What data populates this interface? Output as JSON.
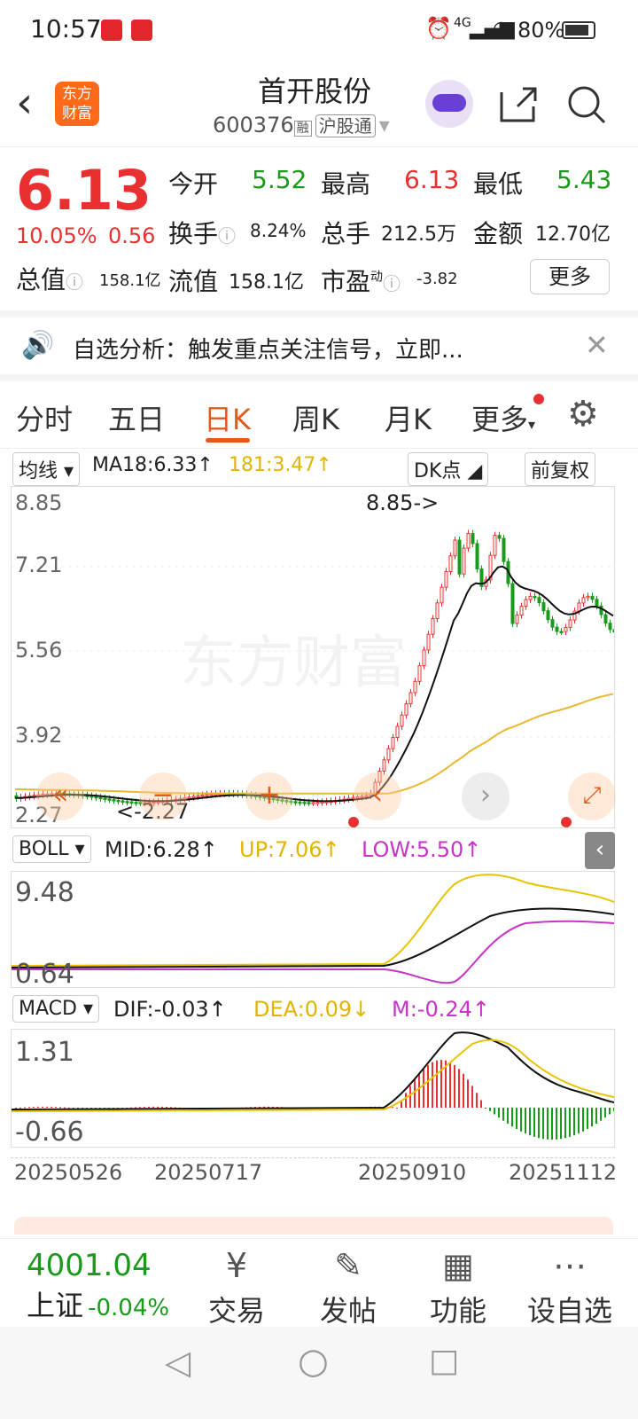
{
  "status": {
    "time": "10:57",
    "network": "4G",
    "battery": "80%"
  },
  "header": {
    "title": "首开股份",
    "code": "600376",
    "tag_rong": "融",
    "tag_hgt": "沪股通",
    "logo_text_1": "东方",
    "logo_text_2": "财富"
  },
  "quote": {
    "price": "6.13",
    "change_pct": "10.05%",
    "change": "0.56",
    "open_label": "今开",
    "open": "5.52",
    "high_label": "最高",
    "high": "6.13",
    "low_label": "最低",
    "low": "5.43",
    "turnover_label": "换手",
    "turnover": "8.24%",
    "volume_label": "总手",
    "volume": "212.5万",
    "amount_label": "金额",
    "amount": "12.70亿",
    "mktcap_label": "总值",
    "mktcap": "158.1亿",
    "float_label": "流值",
    "float": "158.1亿",
    "pe_label": "市盈",
    "pe_sup": "动",
    "pe": "-3.82",
    "more": "更多"
  },
  "banner": {
    "text": "自选分析：触发重点关注信号，立即..."
  },
  "tabs": [
    "分时",
    "五日",
    "日K",
    "周K",
    "月K",
    "更多"
  ],
  "kline": {
    "ma_select": "均线",
    "ma18": "MA18:6.33↑",
    "ma181": "181:3.47↑",
    "dk": "DK点",
    "adjust": "前复权",
    "y_labels": [
      "8.85",
      "7.21",
      "5.56",
      "3.92",
      "2.27"
    ],
    "max_note": "8.85->",
    "min_note": "<-2.27",
    "watermark": "东方财富"
  },
  "boll": {
    "select": "BOLL",
    "mid": "MID:6.28↑",
    "up": "UP:7.06↑",
    "low": "LOW:5.50↑",
    "y_top": "9.48",
    "y_bot": "0.64"
  },
  "macd": {
    "select": "MACD",
    "dif": "DIF:-0.03↑",
    "dea": "DEA:0.09↓",
    "m": "M:-0.24↑",
    "y_top": "1.31",
    "y_bot": "-0.66"
  },
  "x_dates": [
    "20250526",
    "20250717",
    "20250910",
    "20251112"
  ],
  "index": {
    "value": "4001.04",
    "name": "上证",
    "change": "-0.04%"
  },
  "bottom_nav": [
    "交易",
    "发帖",
    "功能",
    "设自选"
  ],
  "colors": {
    "up": "#e93030",
    "down": "#1a9a1a",
    "accent": "#e05a1c"
  }
}
